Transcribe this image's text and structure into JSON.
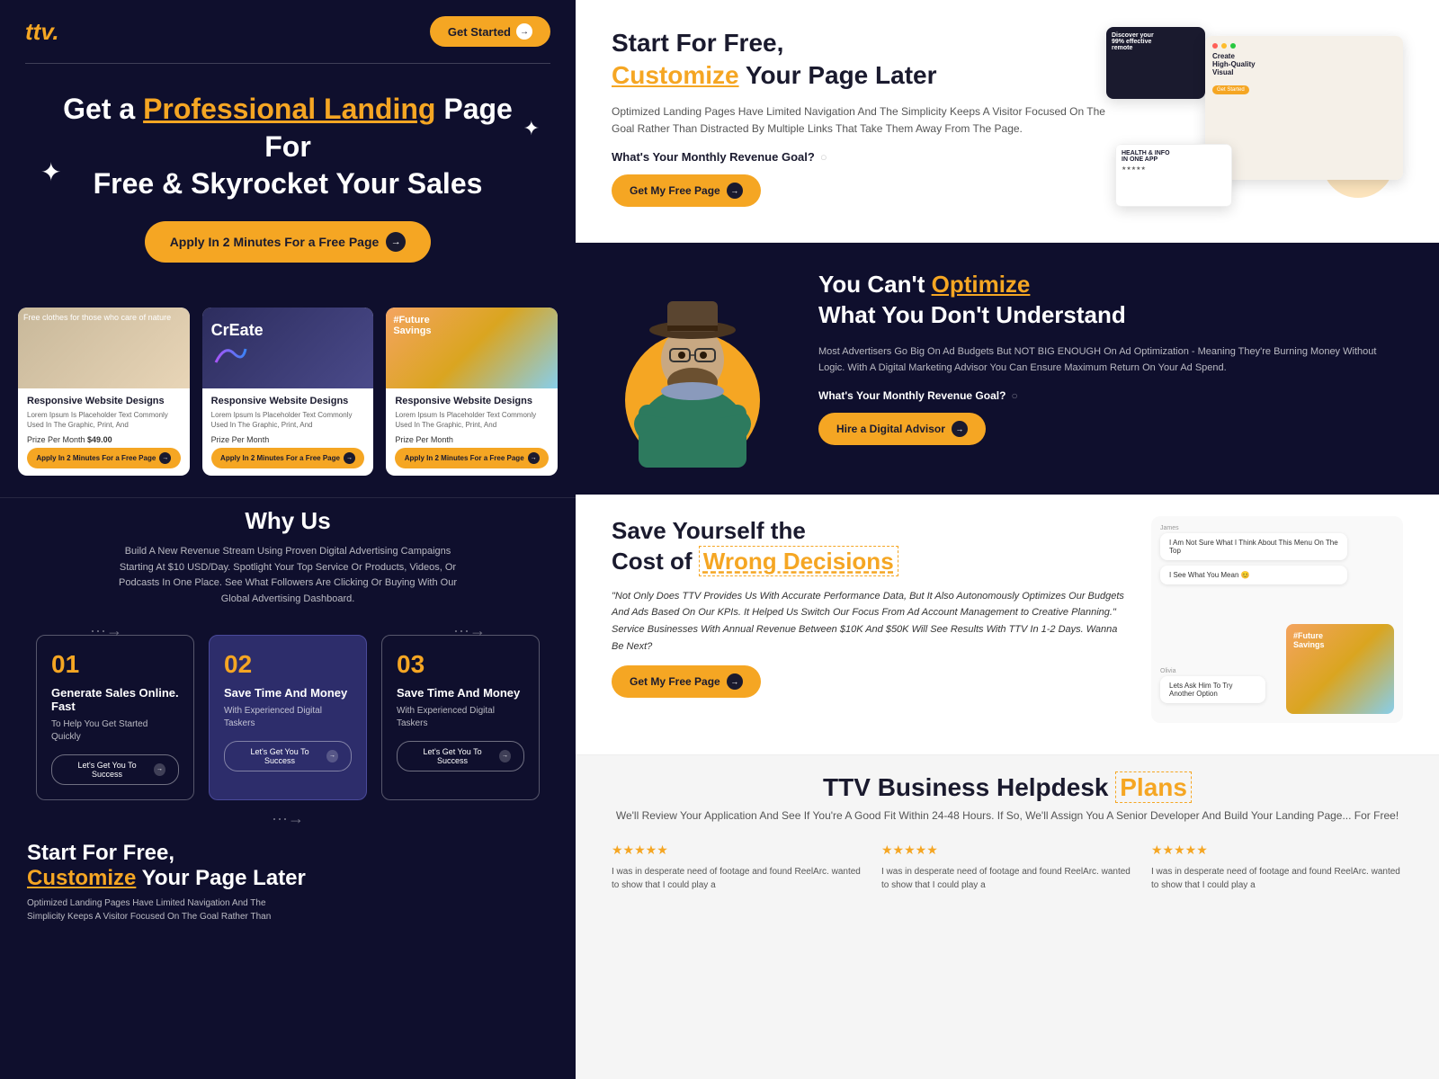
{
  "left": {
    "logo": "ttv.",
    "logo_dot": ".",
    "nav_btn": "Get Started",
    "hero_title_line1": "Get a ",
    "hero_highlight": "Professional Landing",
    "hero_title_line2": " Page For",
    "hero_title_line3": "Free & Skyrocket Your Sales",
    "hero_cta": "Apply In 2 Minutes For a Free Page",
    "cards": [
      {
        "img_label": "Free clothes for those who care of nature",
        "title": "Responsive Website Designs",
        "desc": "Lorem Ipsum Is Placeholder Text Commonly Used In The Graphic, Print, And",
        "price_label": "Prize Per Month",
        "price_val": "$49.00",
        "btn": "Apply In 2 Minutes For a Free Page"
      },
      {
        "img_label": "CREATE",
        "title": "Responsive Website Designs",
        "desc": "Lorem Ipsum Is Placeholder Text Commonly Used In The Graphic, Print, And",
        "price_label": "Prize Per Month",
        "price_val": "",
        "btn": "Apply In 2 Minutes For a Free Page"
      },
      {
        "img_label": "#Future Savings",
        "title": "Responsive Website Designs",
        "desc": "Lorem Ipsum Is Placeholder Text Commonly Used In The Graphic, Print, And",
        "price_label": "Prize Per Month",
        "price_val": "",
        "btn": "Apply In 2 Minutes For a Free Page"
      }
    ],
    "why_us_title": "Why Us",
    "why_us_desc": "Build A New Revenue Stream Using Proven Digital Advertising Campaigns Starting At $10 USD/Day. Spotlight Your Top Service Or Products, Videos, Or Podcasts In One Place. See What Followers Are Clicking Or Buying With Our Global Advertising Dashboard.",
    "steps": [
      {
        "num": "01",
        "title": "Generate Sales Online. Fast",
        "desc": "To Help You Get Started Quickly",
        "btn": "Let's Get You To Success"
      },
      {
        "num": "02",
        "title": "Save Time And Money",
        "desc": "With Experienced Digital Taskers",
        "btn": "Let's Get You To Success"
      },
      {
        "num": "03",
        "title": "Save Time And Money",
        "desc": "With Experienced Digital Taskers",
        "btn": "Let's Get You To Success"
      }
    ],
    "bottom_title_line1": "Start For Free,",
    "bottom_highlight": "Customize",
    "bottom_title_line2": " Your Page Later",
    "bottom_desc": "Optimized Landing Pages Have Limited Navigation And The Simplicity Keeps A Visitor Focused On The Goal Rather Than"
  },
  "right": {
    "sec1": {
      "title_line1": "Start For Free,",
      "highlight": "Customize",
      "title_line2": " Your Page Later",
      "desc": "Optimized Landing Pages Have Limited Navigation And The Simplicity Keeps A Visitor Focused On The Goal Rather Than Distracted By Multiple Links That Take Them Away From The Page.",
      "question": "What's Your Monthly Revenue Goal?",
      "btn": "Get My Free Page"
    },
    "sec2": {
      "title_line1": "You Can't ",
      "highlight": "Optimize",
      "title_line2": " What You Don't Understand",
      "desc": "Most Advertisers Go Big On Ad Budgets But NOT BIG ENOUGH On Ad Optimization - Meaning They're Burning Money Without Logic. With A Digital Marketing Advisor You Can Ensure Maximum Return On Your Ad Spend.",
      "question": "What's Your Monthly Revenue Goal?",
      "btn": "Hire a Digital Advisor"
    },
    "sec3": {
      "title_line1": "Save Yourself the",
      "title_line2": " Cost of ",
      "highlight": "Wrong Decisions",
      "quote": "\"Not Only Does TTV Provides Us With Accurate Performance Data, But It Also Autonomously Optimizes Our Budgets And Ads Based On Our KPIs. It Helped Us Switch Our Focus From Ad Account Management to Creative Planning.\" Service Businesses With Annual Revenue Between $10K And $50K Will See Results With TTV In 1-2 Days. Wanna Be Next?",
      "btn": "Get My Free Page",
      "chat_msgs": [
        {
          "sender": "James",
          "text": "I Am Not Sure What I Think About This Menu On The Top",
          "align": "left"
        },
        {
          "sender": "",
          "text": "I See What You Mean @emoji",
          "align": "left"
        },
        {
          "sender": "Olivia",
          "text": "Lets Ask Him To Try Another Option",
          "align": "left"
        }
      ]
    },
    "sec4": {
      "title_line1": "TTV Business Helpdesk ",
      "highlight": "Plans",
      "desc": "We'll Review Your Application And See If You're A Good Fit Within 24-48 Hours. If So, We'll Assign You A Senior Developer And Build Your Landing Page... For Free!",
      "reviews": [
        {
          "stars": "★★★★★",
          "text": "I was in desperate need of footage and found ReelArc. wanted to show that I could play a"
        },
        {
          "stars": "★★★★★",
          "text": "I was in desperate need of footage and found ReelArc. wanted to show that I could play a"
        },
        {
          "stars": "★★★★★",
          "text": "I was in desperate need of footage and found ReelArc. wanted to show that I could play a"
        }
      ]
    }
  }
}
